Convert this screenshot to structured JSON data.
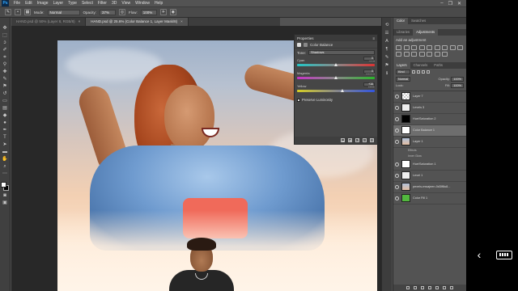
{
  "app": {
    "logo": "Ps"
  },
  "menu": [
    "File",
    "Edit",
    "Image",
    "Layer",
    "Type",
    "Select",
    "Filter",
    "3D",
    "View",
    "Window",
    "Help"
  ],
  "window_controls": [
    "–",
    "❐",
    "✕"
  ],
  "options_bar": {
    "mode_label": "Mode:",
    "mode_value": "Normal",
    "opacity_label": "Opacity:",
    "opacity_value": "37%",
    "flow_label": "Flow:",
    "flow_value": "100%"
  },
  "doc_tabs": [
    {
      "label": "HAND.psd @ 50% (Layer 8, RGB/8)",
      "active": false
    },
    {
      "label": "HAND.psd @ 25.6% (Color Balance 1, Layer Mask/8)",
      "active": true
    }
  ],
  "properties": {
    "header": "Properties",
    "title": "Color Balance",
    "tone_label": "Tone:",
    "tone_value": "Shadows",
    "sliders": [
      {
        "left": "Cyan",
        "right": "Red",
        "value": "0",
        "pos": 0.5,
        "gradient": "linear-gradient(90deg,#22c6c6,#888,#d33)"
      },
      {
        "left": "Magenta",
        "right": "Green",
        "value": "0",
        "pos": 0.5,
        "gradient": "linear-gradient(90deg,#c634c6,#888,#2bb52b)"
      },
      {
        "left": "Yellow",
        "right": "Blue",
        "value": "+16",
        "pos": 0.58,
        "gradient": "linear-gradient(90deg,#d6cf24,#888,#3255e0)"
      }
    ],
    "preserve_label": "Preserve Luminosity"
  },
  "dock": {
    "top_tabs": [
      "Color",
      "Swatches"
    ],
    "adj_tabs": [
      "Libraries",
      "Adjustments"
    ],
    "adj_title": "Add an adjustment",
    "layer_tabs": [
      "Layers",
      "Channels",
      "Paths"
    ],
    "kind_label": "Kind",
    "blend_mode": "Normal",
    "opacity_label": "Opacity:",
    "opacity_value": "100%",
    "lock_label": "Lock:",
    "fill_label": "Fill:",
    "fill_value": "100%",
    "layers": [
      {
        "name": "Layer 7",
        "thumb": "checker",
        "selected": false,
        "sub": false
      },
      {
        "name": "Levels 3",
        "thumb": "adj",
        "selected": false,
        "sub": false
      },
      {
        "name": "Hue/Saturation 2",
        "thumb": "black",
        "selected": false,
        "sub": false
      },
      {
        "name": "Color Balance 1",
        "thumb": "white",
        "selected": true,
        "sub": false
      },
      {
        "name": "Layer 1",
        "thumb": "photo-t",
        "selected": false,
        "sub": false
      },
      {
        "name": "Effects",
        "thumb": "",
        "selected": false,
        "sub": true
      },
      {
        "name": "Inner Glow",
        "thumb": "",
        "selected": false,
        "sub": true
      },
      {
        "name": "Hue/Saturation 1",
        "thumb": "white",
        "selected": false,
        "sub": false
      },
      {
        "name": "Level 1",
        "thumb": "adj",
        "selected": false,
        "sub": false
      },
      {
        "name": "pexels-mwajeen-0d3lf8u8...",
        "thumb": "photo-t",
        "selected": false,
        "sub": false
      },
      {
        "name": "Color Fill 1",
        "thumb": "green",
        "selected": false,
        "sub": false
      }
    ]
  }
}
